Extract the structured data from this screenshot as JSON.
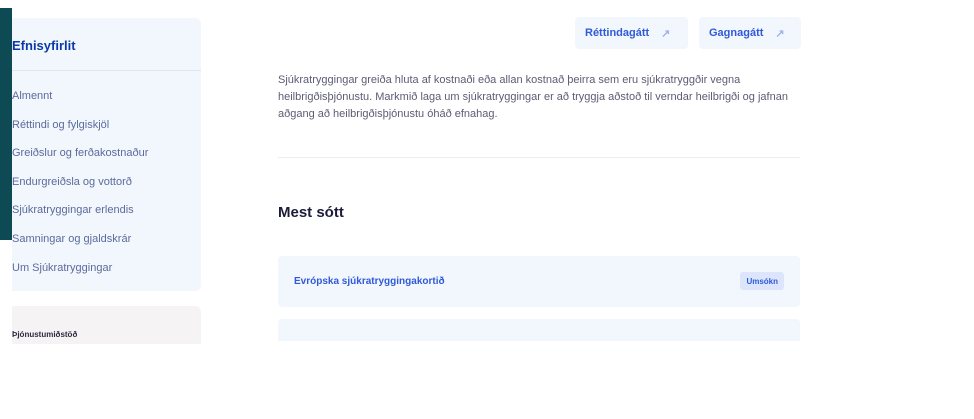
{
  "sidebar": {
    "title": "Efnisyfirlit",
    "items": [
      {
        "label": "Almennt"
      },
      {
        "label": "Réttindi og fylgiskjöl"
      },
      {
        "label": "Greiðslur og ferðakostnaður"
      },
      {
        "label": "Endurgreiðsla og vottorð"
      },
      {
        "label": "Sjúkratryggingar erlendis"
      },
      {
        "label": "Samningar og gjaldskrár"
      },
      {
        "label": "Um Sjúkratryggingar"
      }
    ]
  },
  "sidebar_card2": {
    "label": "Þjónustumiðstöð"
  },
  "top_links": [
    {
      "label": "Réttindagátt",
      "icon": "external-link-icon"
    },
    {
      "label": "Gagnagátt",
      "icon": "external-link-icon"
    }
  ],
  "intro_text": "Sjúkratryggingar greiða hluta af kostnaði eða allan kostnað þeirra sem eru sjúkratryggðir vegna heilbrigðisþjónustu. Markmið laga um sjúkratryggingar er að tryggja aðstoð til verndar heilbrigði og jafnan aðgang að heilbrigðisþjónustu óháð efnahag.",
  "most_visited": {
    "heading": "Mest sótt",
    "items": [
      {
        "label": "Evrópska sjúkratryggingakortið",
        "badge": "Umsókn"
      }
    ]
  },
  "colors": {
    "accent_bar": "#0e4a53",
    "link_blue": "#2f5ad8",
    "panel_bg": "#f2f6fd"
  }
}
